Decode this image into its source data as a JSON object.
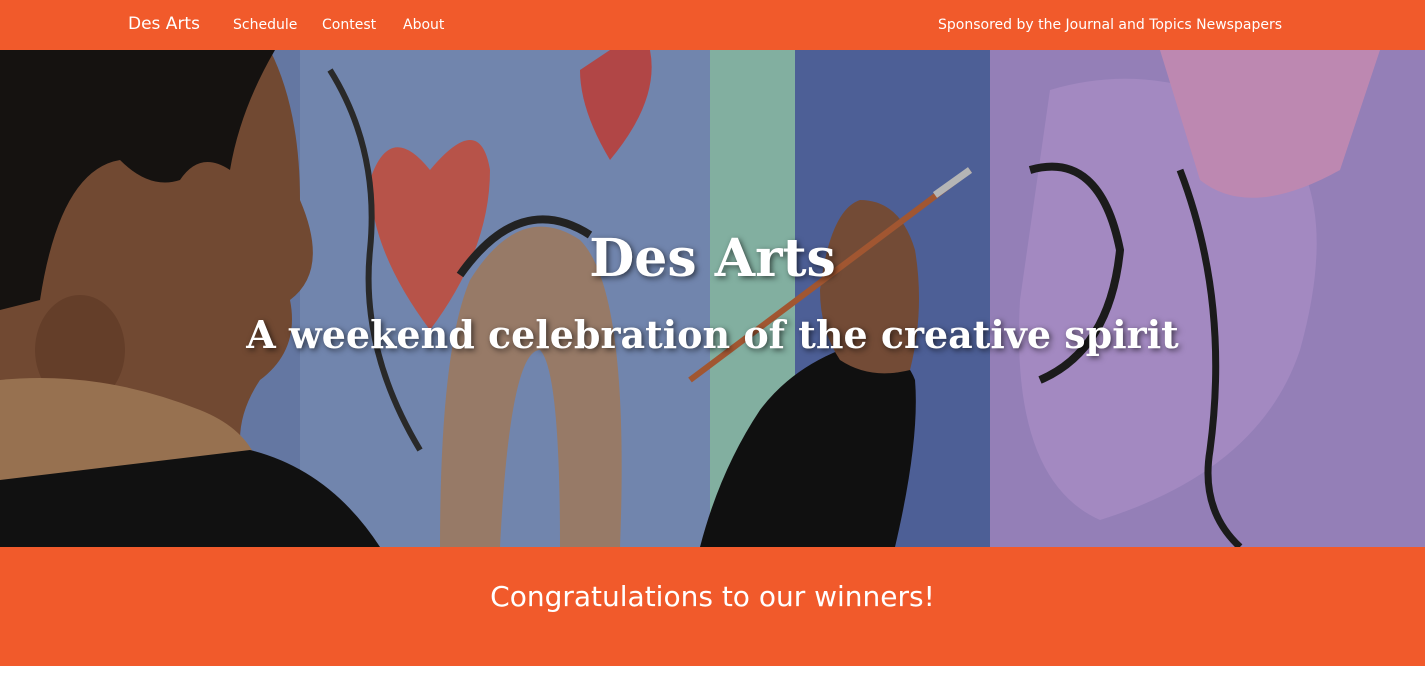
{
  "navbar": {
    "brand": "Des Arts",
    "links": [
      "Schedule",
      "Contest",
      "About"
    ],
    "sponsor": "Sponsored by the Journal and Topics Newspapers",
    "color": "#f15a2b"
  },
  "hero": {
    "title": "Des Arts",
    "subtitle": "A weekend celebration of the creative spirit"
  },
  "banner": {
    "text": "Congratulations to our winners!",
    "color": "#f15a2b"
  }
}
